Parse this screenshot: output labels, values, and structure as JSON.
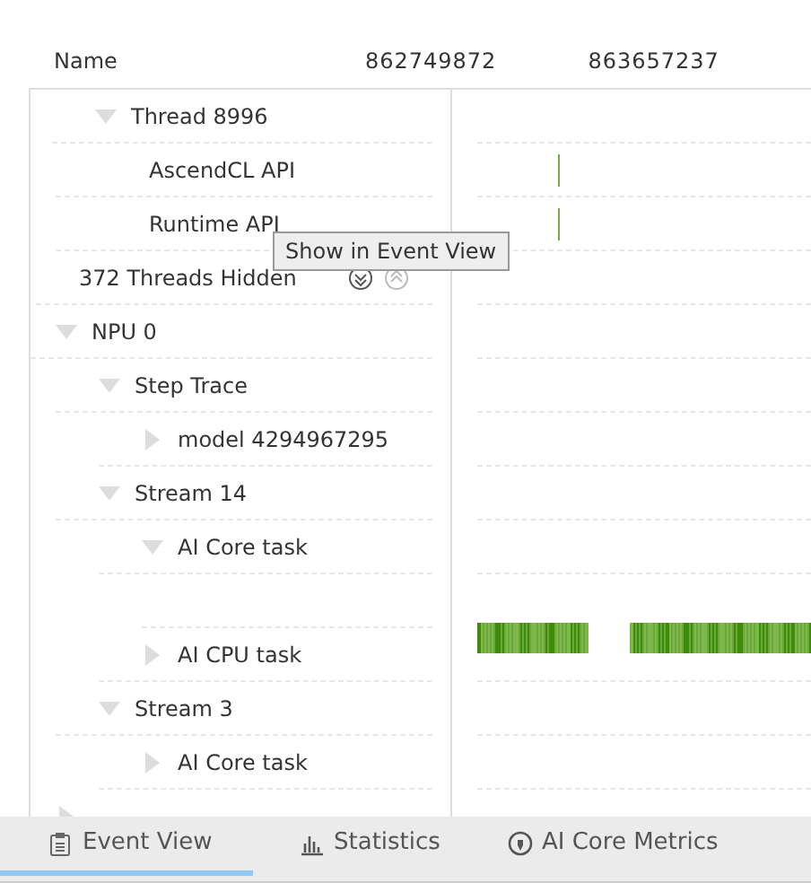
{
  "header": {
    "name_label": "Name",
    "ticks": [
      "862749872",
      "863657237"
    ]
  },
  "tree": [
    {
      "kind": "thread",
      "label": "Thread 8996",
      "expanded": true,
      "children": [
        {
          "kind": "node",
          "label": "AscendCL API",
          "has_events": true
        },
        {
          "kind": "node",
          "label": "Runtime API",
          "has_events": true
        }
      ]
    },
    {
      "kind": "hidden",
      "label": "372 Threads Hidden"
    },
    {
      "kind": "node",
      "label": "NPU 0",
      "expanded": true,
      "children": [
        {
          "kind": "node",
          "label": "Step Trace",
          "expanded": true,
          "children": [
            {
              "kind": "node",
              "label": "model 4294967295",
              "expanded": false
            }
          ]
        },
        {
          "kind": "node",
          "label": "Stream 14",
          "expanded": true,
          "children": [
            {
              "kind": "node",
              "label": "AI Core task",
              "expanded": true,
              "children": [
                {
                  "kind": "track"
                }
              ]
            },
            {
              "kind": "node",
              "label": "AI CPU task",
              "expanded": false
            }
          ]
        },
        {
          "kind": "node",
          "label": "Stream 3",
          "expanded": true,
          "children": [
            {
              "kind": "node",
              "label": "AI Core task",
              "expanded": false
            }
          ]
        }
      ]
    },
    {
      "kind": "node",
      "expanded": false
    }
  ],
  "tooltip": "Show in Event View",
  "tabs": [
    {
      "label": "Event View",
      "selected": true
    },
    {
      "label": "Statistics",
      "selected": false
    },
    {
      "label": "AI Core Metrics",
      "selected": false
    }
  ]
}
